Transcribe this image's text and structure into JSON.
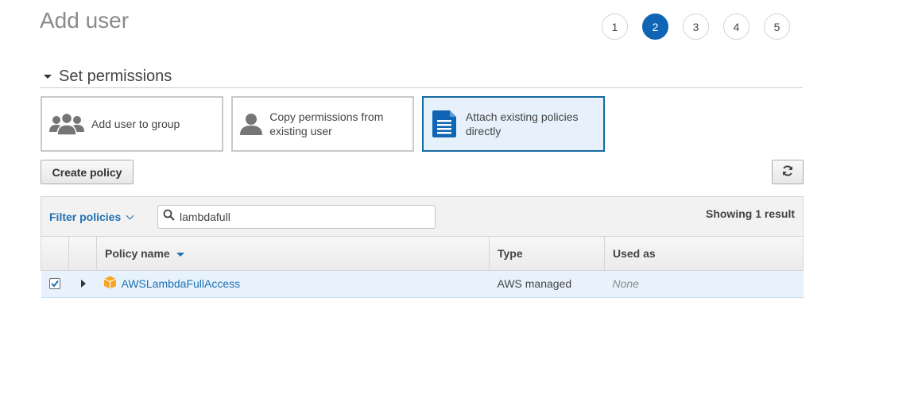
{
  "page": {
    "title": "Add user"
  },
  "steps": [
    "1",
    "2",
    "3",
    "4",
    "5"
  ],
  "active_step": "2",
  "section": {
    "title": "Set permissions"
  },
  "options": [
    {
      "label": "Add user to group",
      "icon": "users-group-icon",
      "selected": false
    },
    {
      "label": "Copy permissions from existing user",
      "icon": "user-icon",
      "selected": false
    },
    {
      "label": "Attach existing policies directly",
      "icon": "document-icon",
      "selected": true
    }
  ],
  "toolbar": {
    "create_policy_label": "Create policy",
    "refresh_icon": "refresh-icon"
  },
  "filter": {
    "label": "Filter policies",
    "search_value": "lambdafull",
    "result_count": "Showing 1 result"
  },
  "table": {
    "columns": [
      "Policy name",
      "Type",
      "Used as"
    ],
    "rows": [
      {
        "checked": true,
        "name": "AWSLambdaFullAccess",
        "type": "AWS managed",
        "used_as": "None",
        "icon": "policy-cube-icon"
      }
    ]
  },
  "colors": {
    "accent": "#0f65b4",
    "link": "#1f6fb2",
    "selected_bg": "#e6f1fb",
    "policy_icon": "#f5a623"
  }
}
